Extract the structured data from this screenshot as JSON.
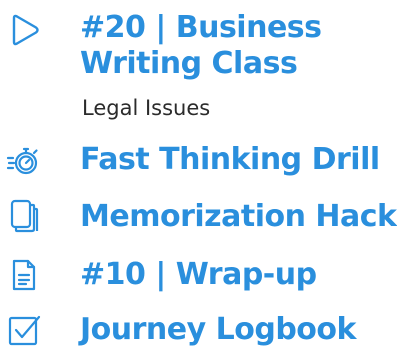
{
  "items": [
    {
      "icon": "play-outline-icon",
      "title_line1": "#20 | Business",
      "title_line2": "Writing Class",
      "subtitle": "Legal Issues"
    },
    {
      "icon": "stopwatch-icon",
      "title": "Fast Thinking Drill"
    },
    {
      "icon": "stacked-pages-icon",
      "title": "Memorization Hack"
    },
    {
      "icon": "document-icon",
      "title": "#10 | Wrap-up"
    },
    {
      "icon": "checkbox-icon",
      "title": "Journey Logbook"
    }
  ],
  "colors": {
    "accent": "#2a8fdd",
    "text": "#2b2b2b"
  }
}
